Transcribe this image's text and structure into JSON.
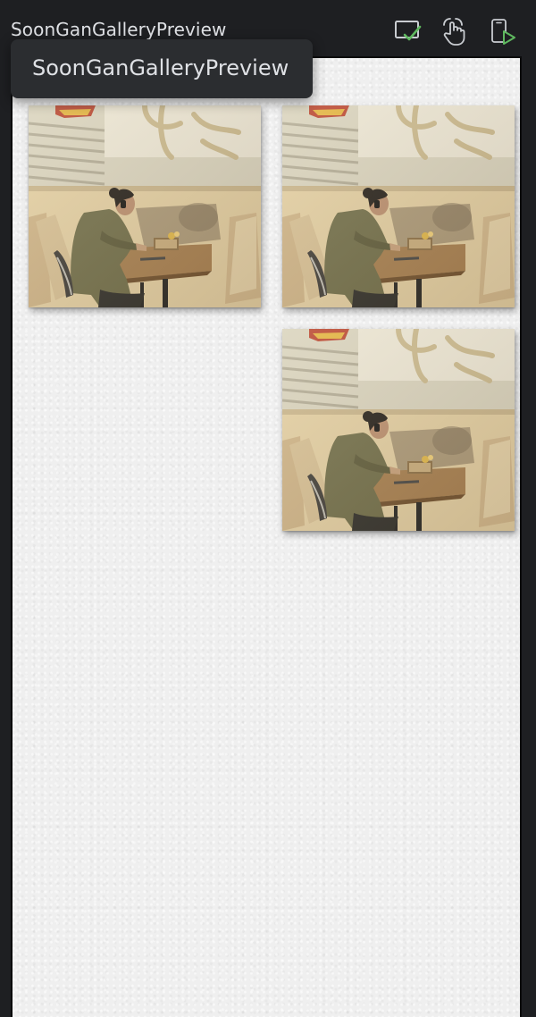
{
  "window": {
    "title": "SoonGanGalleryPreview"
  },
  "tooltip": {
    "text": "SoonGanGalleryPreview"
  },
  "toolbar": {
    "icons": [
      "preview-check-icon",
      "interactive-touch-icon",
      "run-on-device-icon"
    ],
    "colors": {
      "icon": "#c9ccd1",
      "accent": "#5fb85f"
    }
  },
  "gallery": {
    "background": "#efefef",
    "photos": [
      {
        "image": "person-at-cafe-table"
      },
      {
        "image": "person-at-cafe-table"
      },
      {
        "image": "person-at-cafe-table"
      }
    ]
  }
}
